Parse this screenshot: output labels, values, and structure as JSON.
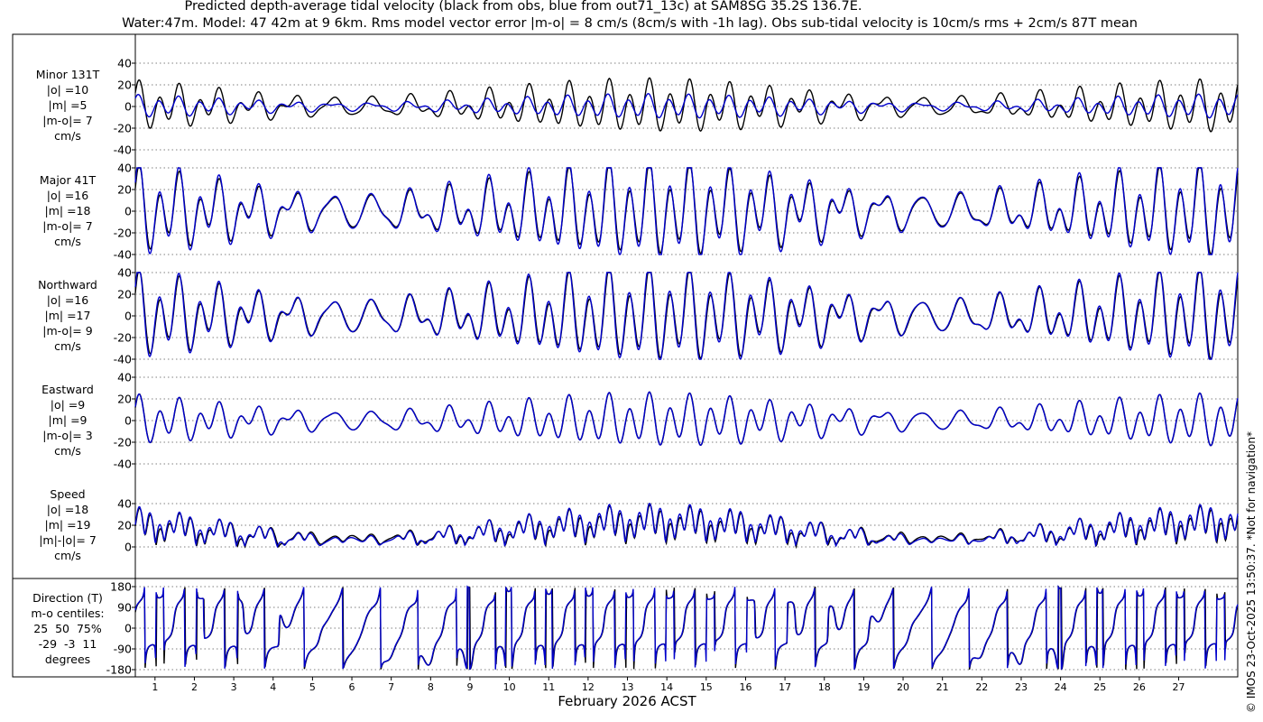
{
  "title_line1": "Predicted depth-average tidal velocity (black from obs, blue from out71_13c) at SAM8SG 35.2S 136.7E.",
  "title_line2": "Water:47m. Model: 47 42m at 9 6km. Rms model vector error |m-o| = 8 cm/s (8cm/s with -1h lag). Obs sub-tidal velocity is 10cm/s rms + 2cm/s 87T mean",
  "xlabel": "February 2026 ACST",
  "credit": "© IMOS 23-Oct-2025 13:50:37. *Not for navigation*",
  "colors": {
    "obs": "#000000",
    "model": "#0000cc",
    "grid": "#555555"
  },
  "chart_data": [
    {
      "type": "line",
      "id": "minor",
      "label_lines": [
        "Minor 131T",
        "|o| =10",
        "|m| =5",
        "|m-o|= 7",
        "cm/s"
      ],
      "ylim": [
        -40,
        40
      ],
      "yticks": [
        "40",
        "20",
        "0",
        "-20",
        "-40"
      ],
      "ytick_values": [
        40,
        20,
        0,
        -20,
        -40
      ],
      "series": [
        {
          "key": "obs",
          "amp": [
            12,
            20,
            8
          ],
          "phase": 0.0
        },
        {
          "key": "model",
          "amp": [
            7,
            6,
            3
          ],
          "phase": 0.4
        }
      ]
    },
    {
      "type": "line",
      "id": "major",
      "label_lines": [
        "Major 41T",
        "|o| =16",
        "|m| =18",
        "|m-o|= 7",
        "cm/s"
      ],
      "ylim": [
        -40,
        40
      ],
      "yticks": [
        "40",
        "20",
        "0",
        "-20",
        "-40"
      ],
      "ytick_values": [
        40,
        20,
        0,
        -20,
        -40
      ],
      "series": [
        {
          "key": "obs",
          "amp": [
            22,
            30,
            14
          ],
          "phase": 0.0
        },
        {
          "key": "model",
          "amp": [
            25,
            34,
            15
          ],
          "phase": 0.1
        }
      ]
    },
    {
      "type": "line",
      "id": "northward",
      "label_lines": [
        "Northward",
        "|o| =16",
        "|m| =17",
        "|m-o|= 9",
        "cm/s"
      ],
      "ylim": [
        -40,
        40
      ],
      "yticks": [
        "40",
        "20",
        "0",
        "-20",
        "-40"
      ],
      "ytick_values": [
        40,
        20,
        0,
        -20,
        -40
      ],
      "series": [
        {
          "key": "obs",
          "amp": [
            22,
            30,
            14
          ],
          "phase": 0.0
        },
        {
          "key": "model",
          "amp": [
            24,
            33,
            14
          ],
          "phase": 0.15
        }
      ]
    },
    {
      "type": "line",
      "id": "eastward",
      "label_lines": [
        "Eastward",
        "|o| =9",
        "|m| =9",
        "|m-o|= 3",
        "cm/s"
      ],
      "ylim": [
        -40,
        40
      ],
      "yticks": [
        "40",
        "20",
        "0",
        "-20",
        "-40"
      ],
      "ytick_values": [
        40,
        20,
        0,
        -20,
        -40
      ],
      "series": [
        {
          "key": "obs",
          "amp": [
            13,
            17,
            8
          ],
          "phase": 0.0
        },
        {
          "key": "model",
          "amp": [
            13,
            17,
            8
          ],
          "phase": 0.05
        }
      ]
    },
    {
      "type": "line",
      "id": "speed",
      "label_lines": [
        "Speed",
        "|o| =18",
        "|m| =19",
        "|m|-|o|= 7",
        "cm/s"
      ],
      "ylim": [
        0,
        40
      ],
      "yticks": [
        "40",
        "20",
        "0"
      ],
      "ytick_values": [
        40,
        20,
        0
      ],
      "series": [
        {
          "key": "obs",
          "amp": [
            22,
            32,
            12
          ],
          "phase": 0.0
        },
        {
          "key": "model",
          "amp": [
            24,
            36,
            10
          ],
          "phase": 0.1
        }
      ]
    },
    {
      "type": "line",
      "id": "direction",
      "label_lines": [
        "Direction (T)",
        "m-o centiles:",
        "25  50  75%",
        "-29  -3  11",
        "degrees"
      ],
      "ylim": [
        -180,
        180
      ],
      "yticks": [
        "180",
        "90",
        "0",
        "-90",
        "-180"
      ],
      "ytick_values": [
        180,
        90,
        0,
        -90,
        -180
      ],
      "series": [
        {
          "key": "obs",
          "amp": [
            1,
            1,
            1
          ],
          "phase": 0.0
        },
        {
          "key": "model",
          "amp": [
            1,
            1,
            1
          ],
          "phase": 0.12
        }
      ]
    }
  ],
  "x_axis": {
    "day_min": 0,
    "day_max": 28,
    "ticks": [
      "1",
      "2",
      "3",
      "4",
      "5",
      "6",
      "7",
      "8",
      "9",
      "10",
      "11",
      "12",
      "13",
      "14",
      "15",
      "16",
      "17",
      "18",
      "19",
      "20",
      "21",
      "22",
      "23",
      "24",
      "25",
      "26",
      "27"
    ]
  }
}
